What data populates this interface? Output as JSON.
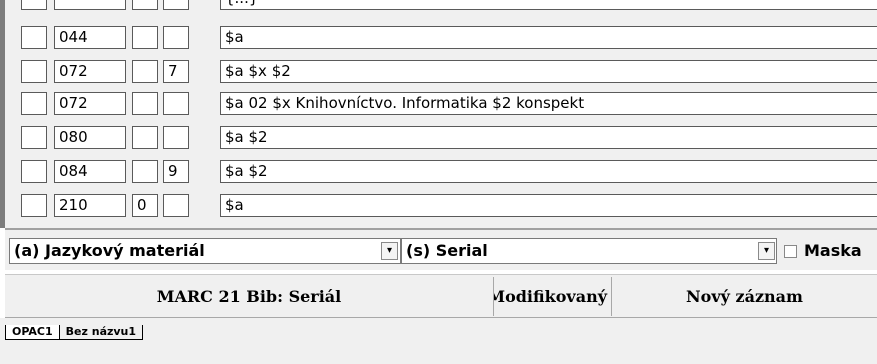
{
  "fields": [
    {
      "tag": "",
      "ind1": "",
      "ind2": "",
      "value": "{...}"
    },
    {
      "tag": "044",
      "ind1": "",
      "ind2": "",
      "value": "$a"
    },
    {
      "tag": "072",
      "ind1": "",
      "ind2": "7",
      "value": "$a  $x  $2"
    },
    {
      "tag": "072",
      "ind1": "",
      "ind2": "",
      "value": "$a 02 $x Knihovníctvo. Informatika $2 konspekt"
    },
    {
      "tag": "080",
      "ind1": "",
      "ind2": "",
      "value": "$a  $2"
    },
    {
      "tag": "084",
      "ind1": "",
      "ind2": "9",
      "value": "$a  $2"
    },
    {
      "tag": "210",
      "ind1": "0",
      "ind2": "",
      "value": "$a"
    }
  ],
  "selectors": {
    "material": "(a) Jazykový materiál",
    "level": "(s) Serial",
    "dropdown_glyph": "▾",
    "mask_label": "Maska"
  },
  "status": {
    "format": "MARC 21 Bib: Seriál",
    "modified": "Modifikovaný",
    "record": "Nový záznam"
  },
  "tabs": [
    {
      "label": "OPAC1",
      "active": true
    },
    {
      "label": "Bez názvu1",
      "active": false
    }
  ],
  "colors": {
    "background": "#f0f0f0",
    "field_border": "#5a5a5a",
    "field_fill": "#ffffff"
  }
}
